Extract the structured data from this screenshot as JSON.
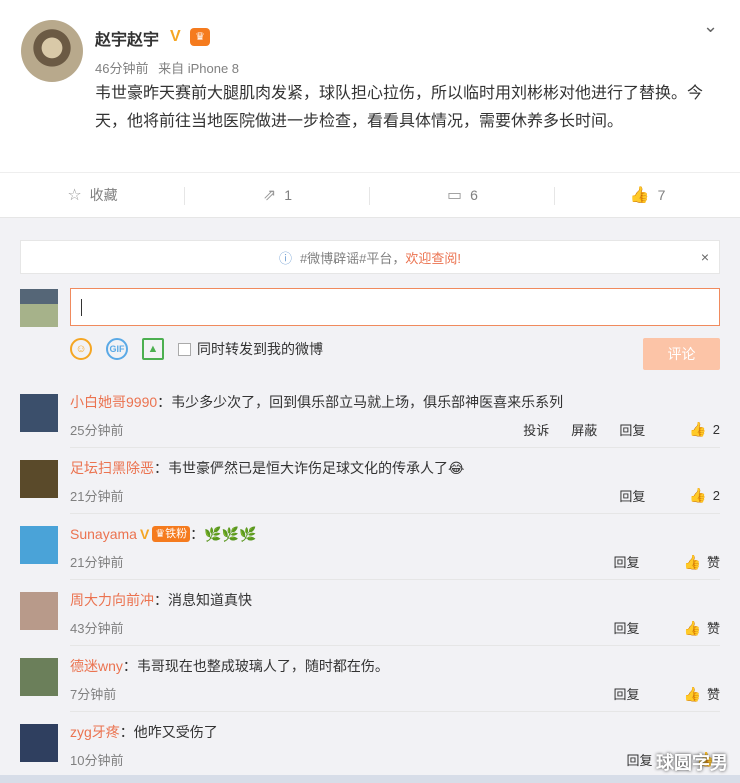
{
  "post": {
    "author": "赵宇赵宇",
    "time": "46分钟前",
    "source": "来自 iPhone 8",
    "text": "韦世豪昨天赛前大腿肌肉发紧，球队担心拉伤，所以临时用刘彬彬对他进行了替换。今天，他将前往当地医院做进一步检查，看看具体情况，需要休养多长时间。",
    "icons": {
      "verified": "verified-v-icon",
      "member": "vip-crown-icon",
      "menu": "chevron-down-icon"
    }
  },
  "actions": [
    {
      "name": "favorite",
      "icon": "star-icon",
      "glyph": "☆",
      "label": "收藏"
    },
    {
      "name": "repost",
      "icon": "share-icon",
      "glyph": "⇗",
      "label": "1"
    },
    {
      "name": "comment",
      "icon": "comment-icon",
      "glyph": "▭",
      "label": "6"
    },
    {
      "name": "like",
      "icon": "thumbs-up-icon",
      "glyph": "👍",
      "label": "7"
    }
  ],
  "notice": {
    "prefix": "#微博辟谣#平台，",
    "link": "欢迎查阅!",
    "close": "×"
  },
  "composer": {
    "placeholder": "",
    "sync_label": "同时转发到我的微博",
    "submit": "评论"
  },
  "comments": [
    {
      "name": "小白她哥9990",
      "text": "韦少多少次了，回到俱乐部立马就上场，俱乐部神医喜来乐系列",
      "time": "25分钟前",
      "actions": [
        "投诉",
        "屏蔽",
        "回复"
      ],
      "likes": "2",
      "avatar_color": "#3b4f6b"
    },
    {
      "name": "足坛扫黑除恶",
      "text": "韦世豪俨然已是恒大诈伤足球文化的传承人了😂",
      "time": "21分钟前",
      "actions": [
        "回复"
      ],
      "likes": "2",
      "avatar_color": "#5a4a2a"
    },
    {
      "name": "Sunayama",
      "badge": "铁粉",
      "text": "🌿🌿🌿",
      "time": "21分钟前",
      "actions": [
        "回复"
      ],
      "likes": "赞",
      "avatar_color": "#4aa3d8"
    },
    {
      "name": "周大力向前冲",
      "text": "消息知道真快",
      "time": "43分钟前",
      "actions": [
        "回复"
      ],
      "likes": "赞",
      "avatar_color": "#b89a8a"
    },
    {
      "name": "德迷wny",
      "text": "韦哥现在也整成玻璃人了，随时都在伤。",
      "time": "7分钟前",
      "actions": [
        "回复"
      ],
      "likes": "赞",
      "avatar_color": "#6b7f5a"
    },
    {
      "name": "zyg牙疼",
      "text": "他咋又受伤了",
      "time": "10分钟前",
      "actions": [
        "回复"
      ],
      "likes": "",
      "avatar_color": "#2f3f5f"
    }
  ],
  "watermark": "球圆字男"
}
